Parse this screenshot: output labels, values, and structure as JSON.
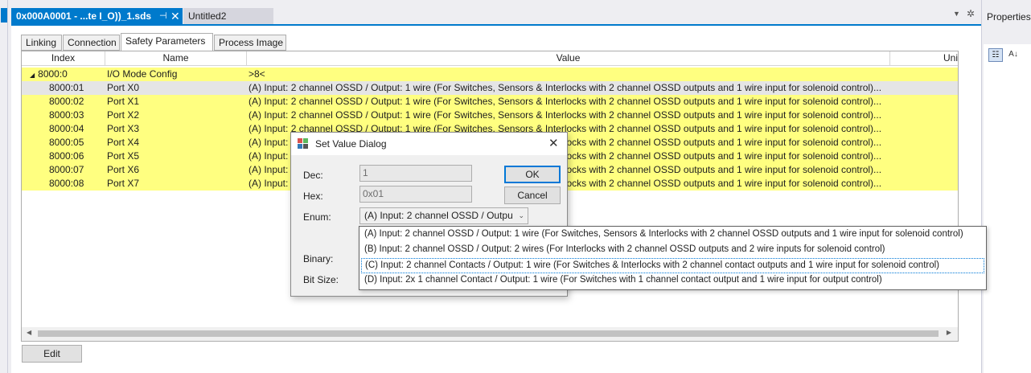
{
  "tabs": {
    "active": "0x000A0001 - ...te I_O))_1.sds",
    "inactive": "Untitled2"
  },
  "sub_tabs": [
    "Linking",
    "Connection",
    "Safety Parameters",
    "Process Image"
  ],
  "grid": {
    "columns": [
      "Index",
      "Name",
      "Value",
      "Uni"
    ],
    "group": {
      "index": "8000:0",
      "name": "I/O Mode Config",
      "value": ">8<"
    },
    "rows": [
      {
        "index": "8000:01",
        "name": "Port X0",
        "value": "(A) Input: 2 channel OSSD / Output: 1 wire (For Switches, Sensors & Interlocks with 2 channel OSSD outputs and 1 wire input for solenoid control)..."
      },
      {
        "index": "8000:02",
        "name": "Port X1",
        "value": "(A) Input: 2 channel OSSD / Output: 1 wire (For Switches, Sensors & Interlocks with 2 channel OSSD outputs and 1 wire input for solenoid control)..."
      },
      {
        "index": "8000:03",
        "name": "Port X2",
        "value": "(A) Input: 2 channel OSSD / Output: 1 wire (For Switches, Sensors & Interlocks with 2 channel OSSD outputs and 1 wire input for solenoid control)..."
      },
      {
        "index": "8000:04",
        "name": "Port X3",
        "value": "(A) Input: 2 channel OSSD / Output: 1 wire (For Switches, Sensors & Interlocks with 2 channel OSSD outputs and 1 wire input for solenoid control)..."
      },
      {
        "index": "8000:05",
        "name": "Port X4",
        "value": "(A) Input: 2 channel OSSD / Output: 1 wire (For Switches, Sensors & Interlocks with 2 channel OSSD outputs and 1 wire input for solenoid control)..."
      },
      {
        "index": "8000:06",
        "name": "Port X5",
        "value": "(A) Input: 2 channel OSSD / Output: 1 wire (For Switches, Sensors & Interlocks with 2 channel OSSD outputs and 1 wire input for solenoid control)..."
      },
      {
        "index": "8000:07",
        "name": "Port X6",
        "value": "(A) Input: 2 channel OSSD / Output: 1 wire (For Switches, Sensors & Interlocks with 2 channel OSSD outputs and 1 wire input for solenoid control)..."
      },
      {
        "index": "8000:08",
        "name": "Port X7",
        "value": "(A) Input: 2 channel OSSD / Output: 1 wire (For Switches, Sensors & Interlocks with 2 channel OSSD outputs and 1 wire input for solenoid control)..."
      }
    ]
  },
  "edit_label": "Edit",
  "properties_title": "Properties",
  "dialog": {
    "title": "Set Value Dialog",
    "dec_label": "Dec:",
    "dec_value": "1",
    "hex_label": "Hex:",
    "hex_value": "0x01",
    "enum_label": "Enum:",
    "enum_value": "(A) Input: 2 channel OSSD / Outpu",
    "binary_label": "Binary:",
    "bitsize_label": "Bit Size:",
    "ok_label": "OK",
    "cancel_label": "Cancel",
    "options": [
      "(A) Input: 2 channel OSSD / Output: 1 wire (For Switches, Sensors & Interlocks with 2 channel OSSD outputs and 1 wire input for solenoid control)",
      "(B) Input: 2 channel OSSD / Output: 2 wires (For Interlocks with 2 channel OSSD outputs and 2 wire inputs for solenoid control)",
      "(C) Input: 2 channel Contacts / Output: 1 wire (For Switches & Interlocks with 2 channel contact outputs and 1 wire input for solenoid control)",
      "(D) Input: 2x 1 channel Contact / Output: 1 wire (For Switches with 1 channel contact output and 1 wire input for output control)"
    ]
  },
  "colors": {
    "accent": "#007acc",
    "row_highlight": "#ffff80"
  }
}
